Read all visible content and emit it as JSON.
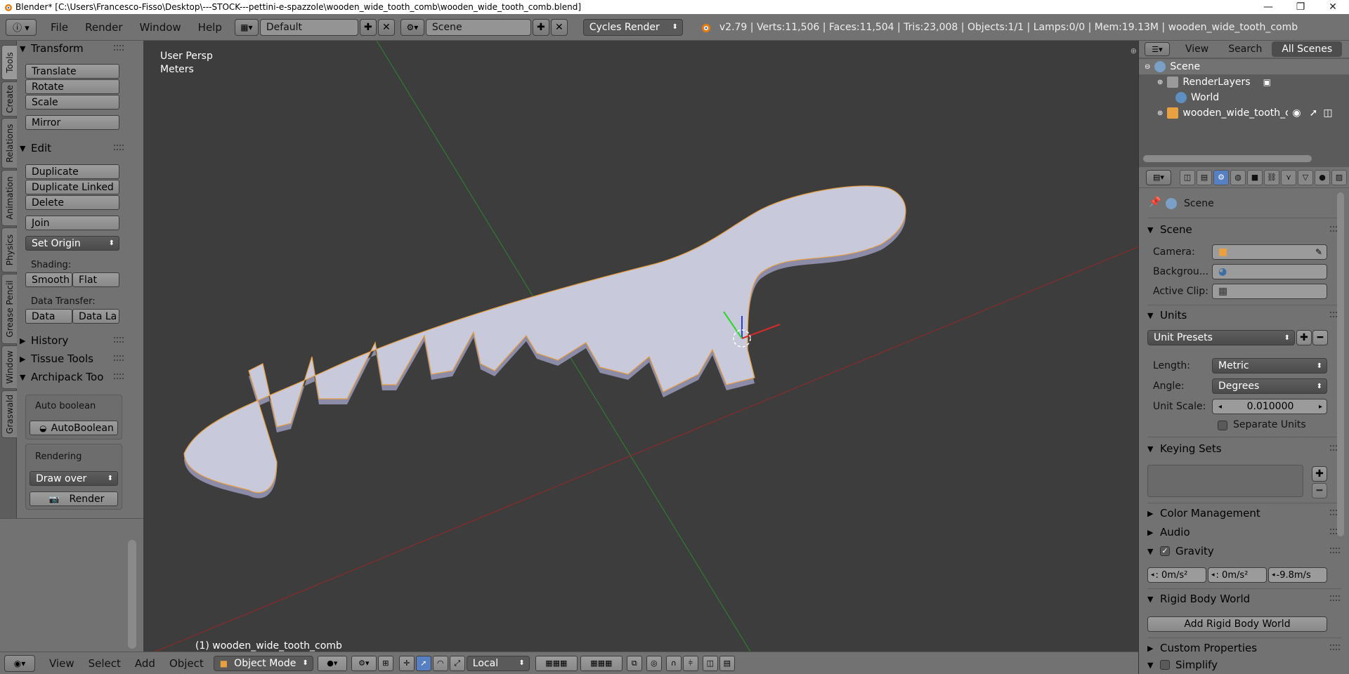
{
  "window": {
    "title": "Blender* [C:\\Users\\Francesco-Fisso\\Desktop\\---STOCK---pettini-e-spazzole\\wooden_wide_tooth_comb\\wooden_wide_tooth_comb.blend]",
    "minimize": "—",
    "restore": "❐",
    "close": "✕"
  },
  "header": {
    "menus": [
      "File",
      "Render",
      "Window",
      "Help"
    ],
    "layout": "Default",
    "scene": "Scene",
    "engine": "Cycles Render",
    "stats": "v2.79 | Verts:11,506 | Faces:11,504 | Tris:23,008 | Objects:1/1 | Lamps:0/0 | Mem:19.13M | wooden_wide_tooth_comb"
  },
  "tool_tabs": [
    "Tools",
    "Create",
    "Relations",
    "Animation",
    "Physics",
    "Grease Pencil",
    "Window",
    "Graswald"
  ],
  "tools": {
    "transform": {
      "title": "Transform",
      "translate": "Translate",
      "rotate": "Rotate",
      "scale": "Scale",
      "mirror": "Mirror"
    },
    "edit": {
      "title": "Edit",
      "duplicate": "Duplicate",
      "duplicate_linked": "Duplicate Linked",
      "delete": "Delete",
      "join": "Join",
      "set_origin": "Set Origin",
      "shading_label": "Shading:",
      "smooth": "Smooth",
      "flat": "Flat",
      "data_transfer_label": "Data Transfer:",
      "data": "Data",
      "data_la": "Data La"
    },
    "history": "History",
    "tissue_tools": "Tissue Tools",
    "archipack": {
      "title": "Archipack Too",
      "auto_boolean_label": "Auto boolean",
      "auto_boolean_btn": "AutoBoolean",
      "rendering_label": "Rendering",
      "draw_over": "Draw over",
      "render_btn": "Render"
    }
  },
  "viewport": {
    "view_name": "User Persp",
    "units": "Meters",
    "object_label": "(1) wooden_wide_tooth_comb"
  },
  "bottom": {
    "menus": [
      "View",
      "Select",
      "Add",
      "Object"
    ],
    "mode": "Object Mode",
    "pivot": "Local"
  },
  "outliner": {
    "tabs": [
      "View",
      "Search",
      "All Scenes"
    ],
    "items": [
      "Scene",
      "RenderLayers",
      "World",
      "wooden_wide_tooth_cc"
    ]
  },
  "properties": {
    "context": "Scene",
    "scene_panel": {
      "title": "Scene",
      "camera_label": "Camera:",
      "background_label": "Backgrou...",
      "active_clip_label": "Active Clip:"
    },
    "units_panel": {
      "title": "Units",
      "presets": "Unit Presets",
      "length_label": "Length:",
      "length_value": "Metric",
      "angle_label": "Angle:",
      "angle_value": "Degrees",
      "unit_scale_label": "Unit Scale:",
      "unit_scale_value": "0.010000",
      "separate_units": "Separate Units"
    },
    "keying_sets": "Keying Sets",
    "color_management": "Color Management",
    "audio": "Audio",
    "gravity": {
      "title": "Gravity",
      "x": ": 0m/s²",
      "y": ": 0m/s²",
      "z": "-9.8m/s"
    },
    "rigid_body_world": {
      "title": "Rigid Body World",
      "add_btn": "Add Rigid Body World"
    },
    "custom_properties": "Custom Properties",
    "simplify": "Simplify"
  },
  "colors": {
    "panel": "#727272",
    "viewport": "#3d3d3d",
    "accent": "#5680c2",
    "comb": "#c9c9dc",
    "outline": "#e8a040"
  }
}
